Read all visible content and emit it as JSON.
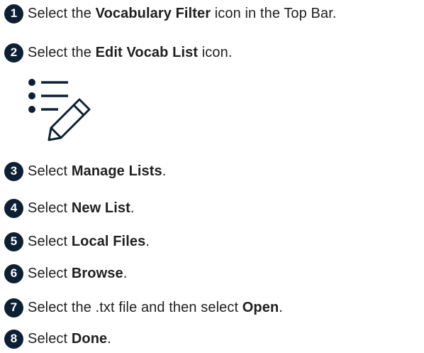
{
  "accent_color": "#0d1f33",
  "edit_vocab_icon": "edit-list-icon",
  "steps": [
    {
      "number": "1",
      "before": "Select the ",
      "bold": "Vocabulary Filter",
      "after": " icon in the Top Bar."
    },
    {
      "number": "2",
      "before": "Select the ",
      "bold": "Edit Vocab List",
      "after": " icon."
    },
    {
      "number": "3",
      "before": "Select ",
      "bold": "Manage Lists",
      "after": "."
    },
    {
      "number": "4",
      "before": "Select ",
      "bold": "New List",
      "after": "."
    },
    {
      "number": "5",
      "before": "Select ",
      "bold": "Local Files",
      "after": "."
    },
    {
      "number": "6",
      "before": "Select ",
      "bold": "Browse",
      "after": "."
    },
    {
      "number": "7",
      "before": "Select the .txt file and then select ",
      "bold": "Open",
      "after": "."
    },
    {
      "number": "8",
      "before": "Select ",
      "bold": "Done",
      "after": "."
    }
  ]
}
